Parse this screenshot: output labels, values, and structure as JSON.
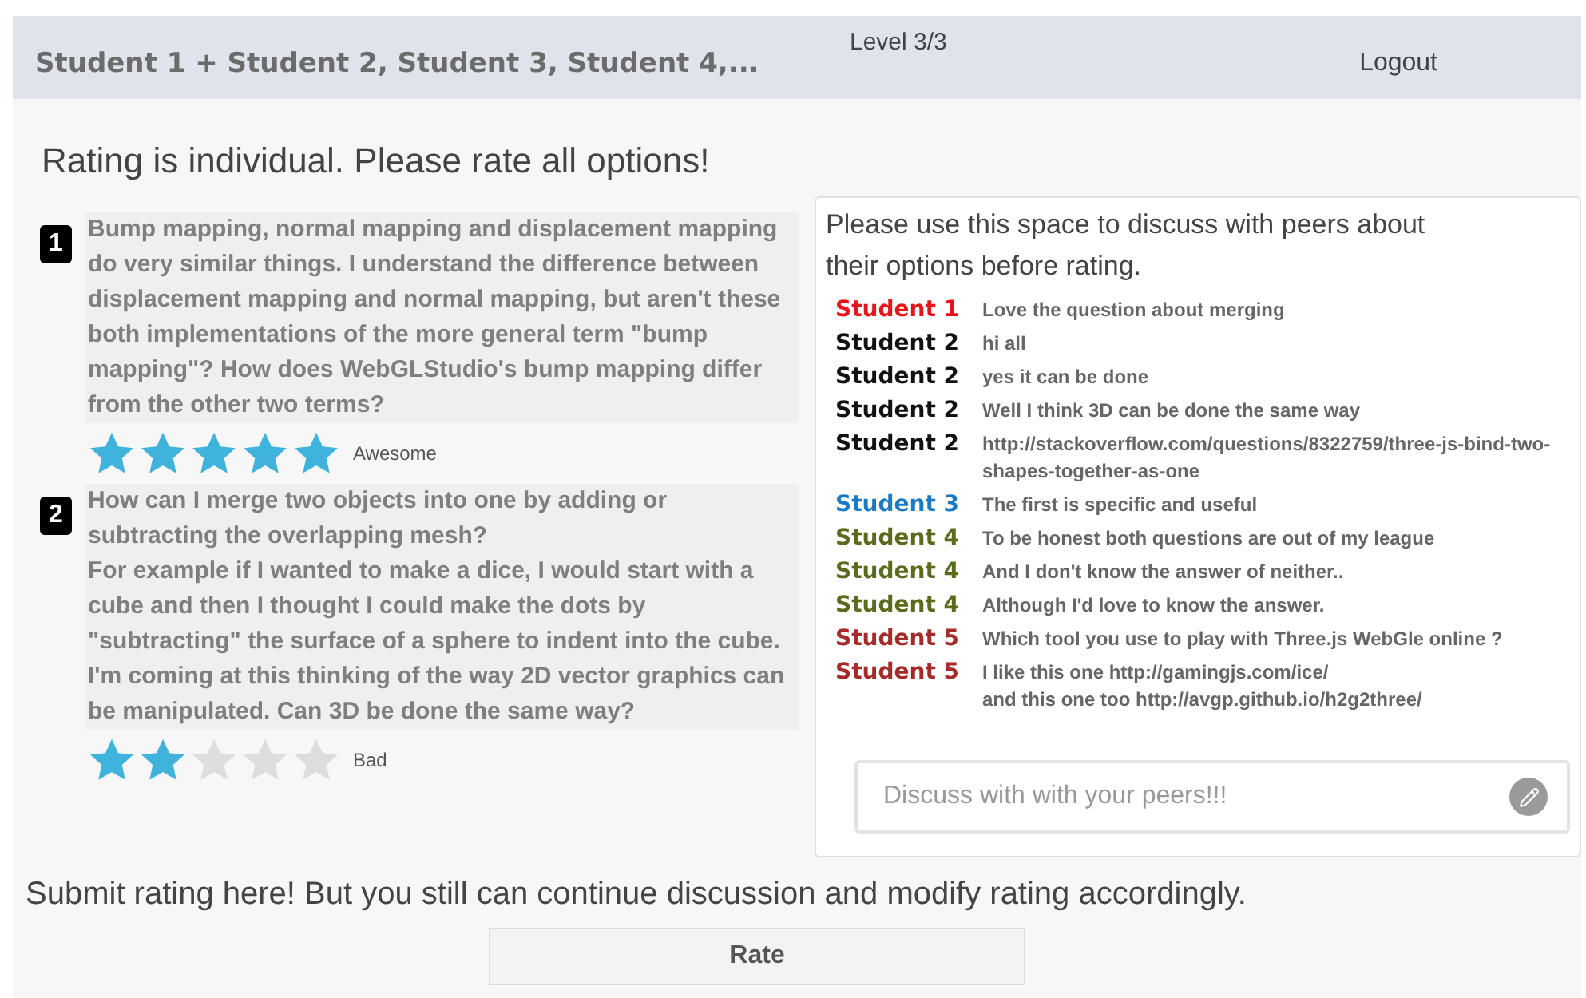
{
  "header": {
    "team": "Student 1 + Student 2, Student 3, Student 4,...",
    "level": "Level 3/3",
    "logout": "Logout"
  },
  "instruction": "Rating is individual. Please rate all options!",
  "questions": [
    {
      "number": "1",
      "text": "Bump mapping, normal mapping and displacement mapping do very similar things. I understand the difference between displacement mapping and normal mapping, but aren't these both implementations of the more general term \"bump mapping\"? How does WebGLStudio's bump mapping differ from the other two terms?",
      "stars": 5,
      "rating_label": "Awesome"
    },
    {
      "number": "2",
      "text": "How can I merge two objects into one by adding or subtracting the overlapping mesh?\nFor example if I wanted to make a dice, I would start with a cube and then I thought I could make the dots by \"subtracting\" the surface of a sphere to indent into the cube.\nI'm coming at this thinking of the way 2D vector graphics can be manipulated. Can 3D be done the same way?",
      "stars": 2,
      "rating_label": "Bad"
    }
  ],
  "discussion": {
    "intro": "Please use this space to discuss with peers about their options before rating.",
    "messages": [
      {
        "author": "Student 1",
        "color": "#e8141b",
        "text": "Love the question about merging"
      },
      {
        "author": "Student 2",
        "color": "#111111",
        "text": "hi all"
      },
      {
        "author": "Student 2",
        "color": "#111111",
        "text": "yes it can be done"
      },
      {
        "author": "Student 2",
        "color": "#111111",
        "text": "Well I think 3D can be done the same way"
      },
      {
        "author": "Student 2",
        "color": "#111111",
        "text": "http://stackoverflow.com/questions/8322759/three-js-bind-two-shapes-together-as-one"
      },
      {
        "author": "Student 3",
        "color": "#1a7ac4",
        "text": "The first is specific and useful"
      },
      {
        "author": "Student 4",
        "color": "#5a6b1e",
        "text": "To be honest both questions are out of my league"
      },
      {
        "author": "Student 4",
        "color": "#5a6b1e",
        "text": "And I don't know the answer of neither.."
      },
      {
        "author": "Student 4",
        "color": "#5a6b1e",
        "text": "Although I'd love to know the answer."
      },
      {
        "author": "Student 5",
        "color": "#a52a2a",
        "text": "Which tool you use to play with Three.js WebGle online ?"
      },
      {
        "author": "Student 5",
        "color": "#a52a2a",
        "text": "I like this one http://gamingjs.com/ice/\nand this one too http://avgp.github.io/h2g2three/"
      }
    ],
    "input": {
      "placeholder": "Discuss with with your peers!!!"
    }
  },
  "submit_note": "Submit rating here! But you still can continue discussion and modify rating accordingly.",
  "rate_button": "Rate"
}
